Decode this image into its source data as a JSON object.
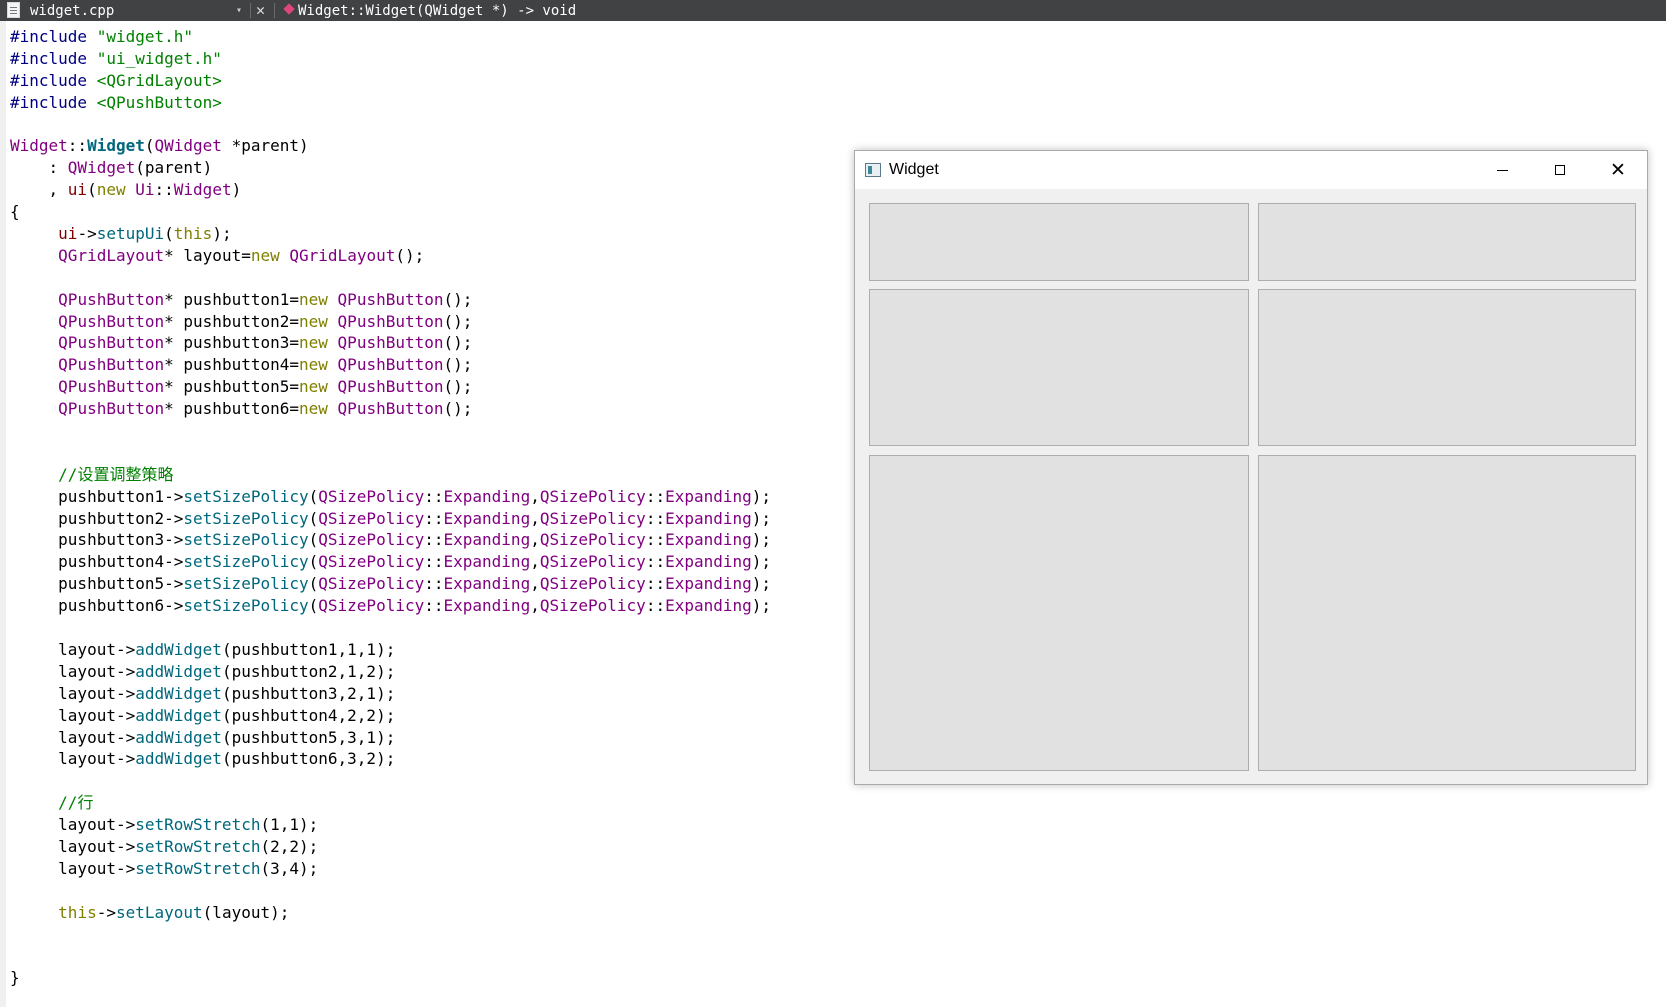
{
  "toolbar": {
    "file_name": "widget.cpp",
    "dropdown_glyph": "▾",
    "close_glyph": "✕",
    "function_signature": "Widget::Widget(QWidget *) -> void"
  },
  "editor": {
    "lines": [
      {
        "tokens": [
          {
            "t": "#include ",
            "c": "pp"
          },
          {
            "t": "\"widget.h\"",
            "c": "str"
          }
        ]
      },
      {
        "tokens": [
          {
            "t": "#include ",
            "c": "pp"
          },
          {
            "t": "\"ui_widget.h\"",
            "c": "str"
          }
        ]
      },
      {
        "tokens": [
          {
            "t": "#include ",
            "c": "pp"
          },
          {
            "t": "<QGridLayout>",
            "c": "str"
          }
        ]
      },
      {
        "tokens": [
          {
            "t": "#include ",
            "c": "pp"
          },
          {
            "t": "<QPushButton>",
            "c": "str"
          }
        ]
      },
      {
        "tokens": []
      },
      {
        "tokens": [
          {
            "t": "Widget",
            "c": "type"
          },
          {
            "t": "::",
            "c": "op"
          },
          {
            "t": "Widget",
            "c": "fnb"
          },
          {
            "t": "(",
            "c": "op"
          },
          {
            "t": "QWidget",
            "c": "type"
          },
          {
            "t": " *parent)",
            "c": "op"
          }
        ]
      },
      {
        "tokens": [
          {
            "t": "    : ",
            "c": "op"
          },
          {
            "t": "QWidget",
            "c": "type"
          },
          {
            "t": "(parent)",
            "c": "op"
          }
        ]
      },
      {
        "tokens": [
          {
            "t": "    , ",
            "c": "op"
          },
          {
            "t": "ui",
            "c": "mem"
          },
          {
            "t": "(",
            "c": "op"
          },
          {
            "t": "new",
            "c": "kw"
          },
          {
            "t": " ",
            "c": "op"
          },
          {
            "t": "Ui",
            "c": "type"
          },
          {
            "t": "::",
            "c": "op"
          },
          {
            "t": "Widget",
            "c": "type"
          },
          {
            "t": ")",
            "c": "op"
          }
        ]
      },
      {
        "tokens": [
          {
            "t": "{",
            "c": "op"
          }
        ]
      },
      {
        "tokens": [
          {
            "t": "     ",
            "c": "op"
          },
          {
            "t": "ui",
            "c": "mem"
          },
          {
            "t": "->",
            "c": "op"
          },
          {
            "t": "setupUi",
            "c": "fn"
          },
          {
            "t": "(",
            "c": "op"
          },
          {
            "t": "this",
            "c": "kw"
          },
          {
            "t": ");",
            "c": "op"
          }
        ]
      },
      {
        "tokens": [
          {
            "t": "     ",
            "c": "op"
          },
          {
            "t": "QGridLayout",
            "c": "type"
          },
          {
            "t": "* layout=",
            "c": "op"
          },
          {
            "t": "new",
            "c": "kw"
          },
          {
            "t": " ",
            "c": "op"
          },
          {
            "t": "QGridLayout",
            "c": "type"
          },
          {
            "t": "();",
            "c": "op"
          }
        ]
      },
      {
        "tokens": []
      },
      {
        "tokens": [
          {
            "t": "     ",
            "c": "op"
          },
          {
            "t": "QPushButton",
            "c": "type"
          },
          {
            "t": "* pushbutton1=",
            "c": "op"
          },
          {
            "t": "new",
            "c": "kw"
          },
          {
            "t": " ",
            "c": "op"
          },
          {
            "t": "QPushButton",
            "c": "type"
          },
          {
            "t": "();",
            "c": "op"
          }
        ]
      },
      {
        "tokens": [
          {
            "t": "     ",
            "c": "op"
          },
          {
            "t": "QPushButton",
            "c": "type"
          },
          {
            "t": "* pushbutton2=",
            "c": "op"
          },
          {
            "t": "new",
            "c": "kw"
          },
          {
            "t": " ",
            "c": "op"
          },
          {
            "t": "QPushButton",
            "c": "type"
          },
          {
            "t": "();",
            "c": "op"
          }
        ]
      },
      {
        "tokens": [
          {
            "t": "     ",
            "c": "op"
          },
          {
            "t": "QPushButton",
            "c": "type"
          },
          {
            "t": "* pushbutton3=",
            "c": "op"
          },
          {
            "t": "new",
            "c": "kw"
          },
          {
            "t": " ",
            "c": "op"
          },
          {
            "t": "QPushButton",
            "c": "type"
          },
          {
            "t": "();",
            "c": "op"
          }
        ]
      },
      {
        "tokens": [
          {
            "t": "     ",
            "c": "op"
          },
          {
            "t": "QPushButton",
            "c": "type"
          },
          {
            "t": "* pushbutton4=",
            "c": "op"
          },
          {
            "t": "new",
            "c": "kw"
          },
          {
            "t": " ",
            "c": "op"
          },
          {
            "t": "QPushButton",
            "c": "type"
          },
          {
            "t": "();",
            "c": "op"
          }
        ]
      },
      {
        "tokens": [
          {
            "t": "     ",
            "c": "op"
          },
          {
            "t": "QPushButton",
            "c": "type"
          },
          {
            "t": "* pushbutton5=",
            "c": "op"
          },
          {
            "t": "new",
            "c": "kw"
          },
          {
            "t": " ",
            "c": "op"
          },
          {
            "t": "QPushButton",
            "c": "type"
          },
          {
            "t": "();",
            "c": "op"
          }
        ]
      },
      {
        "tokens": [
          {
            "t": "     ",
            "c": "op"
          },
          {
            "t": "QPushButton",
            "c": "type"
          },
          {
            "t": "* pushbutton6=",
            "c": "op"
          },
          {
            "t": "new",
            "c": "kw"
          },
          {
            "t": " ",
            "c": "op"
          },
          {
            "t": "QPushButton",
            "c": "type"
          },
          {
            "t": "();",
            "c": "op"
          }
        ]
      },
      {
        "tokens": []
      },
      {
        "tokens": []
      },
      {
        "tokens": [
          {
            "t": "     ",
            "c": "op"
          },
          {
            "t": "//设置调整策略",
            "c": "cm"
          }
        ]
      },
      {
        "tokens": [
          {
            "t": "     pushbutton1->",
            "c": "op"
          },
          {
            "t": "setSizePolicy",
            "c": "fn"
          },
          {
            "t": "(",
            "c": "op"
          },
          {
            "t": "QSizePolicy",
            "c": "type"
          },
          {
            "t": "::",
            "c": "op"
          },
          {
            "t": "Expanding",
            "c": "type"
          },
          {
            "t": ",",
            "c": "op"
          },
          {
            "t": "QSizePolicy",
            "c": "type"
          },
          {
            "t": "::",
            "c": "op"
          },
          {
            "t": "Expanding",
            "c": "type"
          },
          {
            "t": ");",
            "c": "op"
          }
        ]
      },
      {
        "tokens": [
          {
            "t": "     pushbutton2->",
            "c": "op"
          },
          {
            "t": "setSizePolicy",
            "c": "fn"
          },
          {
            "t": "(",
            "c": "op"
          },
          {
            "t": "QSizePolicy",
            "c": "type"
          },
          {
            "t": "::",
            "c": "op"
          },
          {
            "t": "Expanding",
            "c": "type"
          },
          {
            "t": ",",
            "c": "op"
          },
          {
            "t": "QSizePolicy",
            "c": "type"
          },
          {
            "t": "::",
            "c": "op"
          },
          {
            "t": "Expanding",
            "c": "type"
          },
          {
            "t": ");",
            "c": "op"
          }
        ]
      },
      {
        "tokens": [
          {
            "t": "     pushbutton3->",
            "c": "op"
          },
          {
            "t": "setSizePolicy",
            "c": "fn"
          },
          {
            "t": "(",
            "c": "op"
          },
          {
            "t": "QSizePolicy",
            "c": "type"
          },
          {
            "t": "::",
            "c": "op"
          },
          {
            "t": "Expanding",
            "c": "type"
          },
          {
            "t": ",",
            "c": "op"
          },
          {
            "t": "QSizePolicy",
            "c": "type"
          },
          {
            "t": "::",
            "c": "op"
          },
          {
            "t": "Expanding",
            "c": "type"
          },
          {
            "t": ");",
            "c": "op"
          }
        ]
      },
      {
        "tokens": [
          {
            "t": "     pushbutton4->",
            "c": "op"
          },
          {
            "t": "setSizePolicy",
            "c": "fn"
          },
          {
            "t": "(",
            "c": "op"
          },
          {
            "t": "QSizePolicy",
            "c": "type"
          },
          {
            "t": "::",
            "c": "op"
          },
          {
            "t": "Expanding",
            "c": "type"
          },
          {
            "t": ",",
            "c": "op"
          },
          {
            "t": "QSizePolicy",
            "c": "type"
          },
          {
            "t": "::",
            "c": "op"
          },
          {
            "t": "Expanding",
            "c": "type"
          },
          {
            "t": ");",
            "c": "op"
          }
        ]
      },
      {
        "tokens": [
          {
            "t": "     pushbutton5->",
            "c": "op"
          },
          {
            "t": "setSizePolicy",
            "c": "fn"
          },
          {
            "t": "(",
            "c": "op"
          },
          {
            "t": "QSizePolicy",
            "c": "type"
          },
          {
            "t": "::",
            "c": "op"
          },
          {
            "t": "Expanding",
            "c": "type"
          },
          {
            "t": ",",
            "c": "op"
          },
          {
            "t": "QSizePolicy",
            "c": "type"
          },
          {
            "t": "::",
            "c": "op"
          },
          {
            "t": "Expanding",
            "c": "type"
          },
          {
            "t": ");",
            "c": "op"
          }
        ]
      },
      {
        "tokens": [
          {
            "t": "     pushbutton6->",
            "c": "op"
          },
          {
            "t": "setSizePolicy",
            "c": "fn"
          },
          {
            "t": "(",
            "c": "op"
          },
          {
            "t": "QSizePolicy",
            "c": "type"
          },
          {
            "t": "::",
            "c": "op"
          },
          {
            "t": "Expanding",
            "c": "type"
          },
          {
            "t": ",",
            "c": "op"
          },
          {
            "t": "QSizePolicy",
            "c": "type"
          },
          {
            "t": "::",
            "c": "op"
          },
          {
            "t": "Expanding",
            "c": "type"
          },
          {
            "t": ");",
            "c": "op"
          }
        ]
      },
      {
        "tokens": []
      },
      {
        "tokens": [
          {
            "t": "     layout->",
            "c": "op"
          },
          {
            "t": "addWidget",
            "c": "fn"
          },
          {
            "t": "(pushbutton1,1,1);",
            "c": "op"
          }
        ]
      },
      {
        "tokens": [
          {
            "t": "     layout->",
            "c": "op"
          },
          {
            "t": "addWidget",
            "c": "fn"
          },
          {
            "t": "(pushbutton2,1,2);",
            "c": "op"
          }
        ]
      },
      {
        "tokens": [
          {
            "t": "     layout->",
            "c": "op"
          },
          {
            "t": "addWidget",
            "c": "fn"
          },
          {
            "t": "(pushbutton3,2,1);",
            "c": "op"
          }
        ]
      },
      {
        "tokens": [
          {
            "t": "     layout->",
            "c": "op"
          },
          {
            "t": "addWidget",
            "c": "fn"
          },
          {
            "t": "(pushbutton4,2,2);",
            "c": "op"
          }
        ]
      },
      {
        "tokens": [
          {
            "t": "     layout->",
            "c": "op"
          },
          {
            "t": "addWidget",
            "c": "fn"
          },
          {
            "t": "(pushbutton5,3,1);",
            "c": "op"
          }
        ]
      },
      {
        "tokens": [
          {
            "t": "     layout->",
            "c": "op"
          },
          {
            "t": "addWidget",
            "c": "fn"
          },
          {
            "t": "(pushbutton6,3,2);",
            "c": "op"
          }
        ]
      },
      {
        "tokens": []
      },
      {
        "tokens": [
          {
            "t": "     ",
            "c": "op"
          },
          {
            "t": "//行",
            "c": "cm"
          }
        ]
      },
      {
        "tokens": [
          {
            "t": "     layout->",
            "c": "op"
          },
          {
            "t": "setRowStretch",
            "c": "fn"
          },
          {
            "t": "(1,1);",
            "c": "op"
          }
        ]
      },
      {
        "tokens": [
          {
            "t": "     layout->",
            "c": "op"
          },
          {
            "t": "setRowStretch",
            "c": "fn"
          },
          {
            "t": "(2,2);",
            "c": "op"
          }
        ]
      },
      {
        "tokens": [
          {
            "t": "     layout->",
            "c": "op"
          },
          {
            "t": "setRowStretch",
            "c": "fn"
          },
          {
            "t": "(3,4);",
            "c": "op"
          }
        ]
      },
      {
        "tokens": []
      },
      {
        "tokens": [
          {
            "t": "     ",
            "c": "op"
          },
          {
            "t": "this",
            "c": "kw"
          },
          {
            "t": "->",
            "c": "op"
          },
          {
            "t": "setLayout",
            "c": "fn"
          },
          {
            "t": "(layout);",
            "c": "op"
          }
        ]
      },
      {
        "tokens": []
      },
      {
        "tokens": []
      },
      {
        "tokens": [
          {
            "t": "}",
            "c": "op"
          }
        ]
      }
    ]
  },
  "widget_window": {
    "title": "Widget",
    "minimize_glyph": "",
    "close_glyph": "✕"
  }
}
